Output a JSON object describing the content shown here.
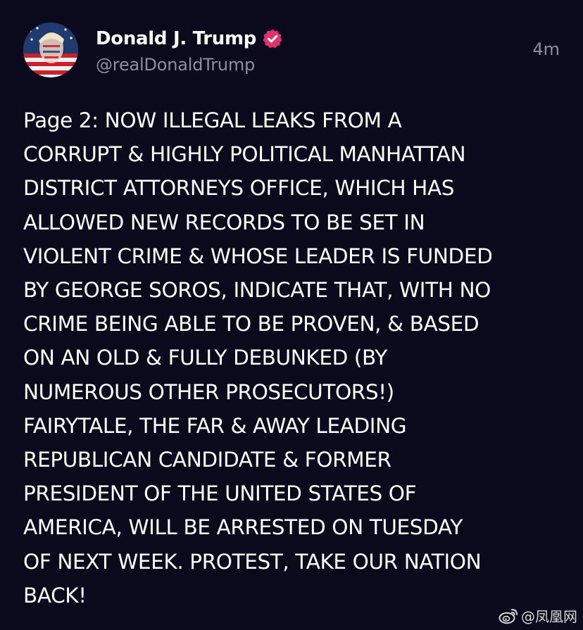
{
  "author": {
    "display_name": "Donald J. Trump",
    "handle": "@realDonaldTrump",
    "verified": true,
    "badge_color": "#e0336b",
    "avatar_icon": "profile-photo-flag-portrait"
  },
  "post": {
    "timestamp": "4m",
    "text": "Page 2: NOW ILLEGAL LEAKS FROM A\nCORRUPT & HIGHLY POLITICAL MANHATTAN\nDISTRICT ATTORNEYS OFFICE, WHICH HAS\nALLOWED NEW RECORDS TO BE SET IN\nVIOLENT CRIME & WHOSE LEADER IS FUNDED\nBY GEORGE SOROS, INDICATE THAT, WITH NO\nCRIME BEING ABLE TO BE PROVEN, & BASED\nON AN OLD & FULLY DEBUNKED (BY\nNUMEROUS OTHER PROSECUTORS!)\nFAIRYTALE, THE FAR & AWAY LEADING\nREPUBLICAN CANDIDATE & FORMER\nPRESIDENT OF THE UNITED STATES OF\nAMERICA, WILL BE ARRESTED ON TUESDAY\nOF NEXT WEEK. PROTEST, TAKE OUR NATION\nBACK!"
  },
  "watermark": {
    "icon": "weibo-icon",
    "text": "@凤凰网"
  },
  "colors": {
    "background": "#0a0a1c",
    "text": "#ffffff",
    "muted": "#8e8f9e"
  }
}
